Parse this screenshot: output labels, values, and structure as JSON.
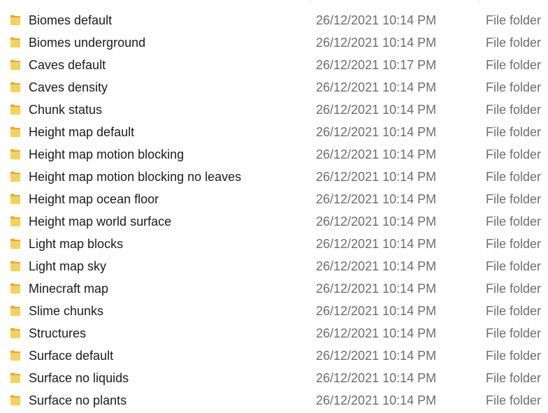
{
  "colors": {
    "name_text": "#1b1b1b",
    "secondary_text": "#6d6d6d",
    "folder_icon_front": "#f7d25a",
    "folder_icon_back": "#e3aa33"
  },
  "file_list": {
    "rows": [
      {
        "name": "Biomes default",
        "date_modified": "26/12/2021 10:14 PM",
        "type": "File folder",
        "icon": "folder-icon"
      },
      {
        "name": "Biomes underground",
        "date_modified": "26/12/2021 10:14 PM",
        "type": "File folder",
        "icon": "folder-icon"
      },
      {
        "name": "Caves default",
        "date_modified": "26/12/2021 10:17 PM",
        "type": "File folder",
        "icon": "folder-icon"
      },
      {
        "name": "Caves density",
        "date_modified": "26/12/2021 10:14 PM",
        "type": "File folder",
        "icon": "folder-icon"
      },
      {
        "name": "Chunk status",
        "date_modified": "26/12/2021 10:14 PM",
        "type": "File folder",
        "icon": "folder-icon"
      },
      {
        "name": "Height map default",
        "date_modified": "26/12/2021 10:14 PM",
        "type": "File folder",
        "icon": "folder-icon"
      },
      {
        "name": "Height map motion blocking",
        "date_modified": "26/12/2021 10:14 PM",
        "type": "File folder",
        "icon": "folder-icon"
      },
      {
        "name": "Height map motion blocking no leaves",
        "date_modified": "26/12/2021 10:14 PM",
        "type": "File folder",
        "icon": "folder-icon"
      },
      {
        "name": "Height map ocean floor",
        "date_modified": "26/12/2021 10:14 PM",
        "type": "File folder",
        "icon": "folder-icon"
      },
      {
        "name": "Height map world surface",
        "date_modified": "26/12/2021 10:14 PM",
        "type": "File folder",
        "icon": "folder-icon"
      },
      {
        "name": "Light map blocks",
        "date_modified": "26/12/2021 10:14 PM",
        "type": "File folder",
        "icon": "folder-icon"
      },
      {
        "name": "Light map sky",
        "date_modified": "26/12/2021 10:14 PM",
        "type": "File folder",
        "icon": "folder-icon"
      },
      {
        "name": "Minecraft map",
        "date_modified": "26/12/2021 10:14 PM",
        "type": "File folder",
        "icon": "folder-icon"
      },
      {
        "name": "Slime chunks",
        "date_modified": "26/12/2021 10:14 PM",
        "type": "File folder",
        "icon": "folder-icon"
      },
      {
        "name": "Structures",
        "date_modified": "26/12/2021 10:14 PM",
        "type": "File folder",
        "icon": "folder-icon"
      },
      {
        "name": "Surface default",
        "date_modified": "26/12/2021 10:14 PM",
        "type": "File folder",
        "icon": "folder-icon"
      },
      {
        "name": "Surface no liquids",
        "date_modified": "26/12/2021 10:14 PM",
        "type": "File folder",
        "icon": "folder-icon"
      },
      {
        "name": "Surface no plants",
        "date_modified": "26/12/2021 10:14 PM",
        "type": "File folder",
        "icon": "folder-icon"
      }
    ]
  }
}
